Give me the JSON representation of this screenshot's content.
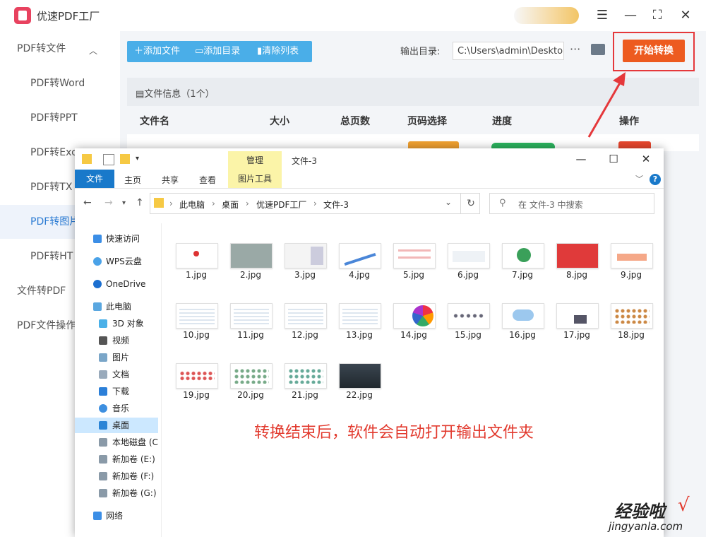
{
  "app": {
    "title": "优速PDF工厂"
  },
  "sidebar": {
    "items": [
      {
        "label": "PDF转文件"
      },
      {
        "label": "PDF转Word"
      },
      {
        "label": "PDF转PPT"
      },
      {
        "label": "PDF转Exc"
      },
      {
        "label": "PDF转TX"
      },
      {
        "label": "PDF转图片"
      },
      {
        "label": "PDF转HT"
      },
      {
        "label": "文件转PDF"
      },
      {
        "label": "PDF文件操作"
      }
    ]
  },
  "toolbar": {
    "add_file": "添加文件",
    "add_folder": "添加目录",
    "clear_list": "清除列表",
    "output_label": "输出目录:",
    "output_path": "C:\\Users\\admin\\Deskto",
    "more": "···",
    "start": "开始转换"
  },
  "file_info": {
    "label": "文件信息（1个）"
  },
  "table": {
    "headers": [
      "文件名",
      "大小",
      "总页数",
      "页码选择",
      "进度",
      "操作"
    ]
  },
  "explorer": {
    "title": "文件-3",
    "manage_tab": "管理",
    "picture_tools": "图片工具",
    "ribbon_tabs": [
      "文件",
      "主页",
      "共享",
      "查看"
    ],
    "breadcrumb": [
      "此电脑",
      "桌面",
      "优速PDF工厂",
      "文件-3"
    ],
    "search_placeholder": "在 文件-3 中搜索",
    "nav": [
      {
        "label": "快速访问"
      },
      {
        "label": "WPS云盘"
      },
      {
        "label": "OneDrive"
      },
      {
        "label": "此电脑"
      },
      {
        "label": "3D 对象"
      },
      {
        "label": "视频"
      },
      {
        "label": "图片"
      },
      {
        "label": "文档"
      },
      {
        "label": "下载"
      },
      {
        "label": "音乐"
      },
      {
        "label": "桌面"
      },
      {
        "label": "本地磁盘 (C"
      },
      {
        "label": "新加卷 (E:)"
      },
      {
        "label": "新加卷 (F:)"
      },
      {
        "label": "新加卷 (G:)"
      },
      {
        "label": "网络"
      }
    ],
    "files": [
      "1.jpg",
      "2.jpg",
      "3.jpg",
      "4.jpg",
      "5.jpg",
      "6.jpg",
      "7.jpg",
      "8.jpg",
      "9.jpg",
      "10.jpg",
      "11.jpg",
      "12.jpg",
      "13.jpg",
      "14.jpg",
      "15.jpg",
      "16.jpg",
      "17.jpg",
      "18.jpg",
      "19.jpg",
      "20.jpg",
      "21.jpg",
      "22.jpg"
    ]
  },
  "caption": "转换结束后，软件会自动打开输出文件夹",
  "watermark": {
    "title": "经验啦",
    "url": "jingyanla.com",
    "check": "√"
  },
  "colors": {
    "accent": "#ed5b20",
    "highlight": "#e5383b",
    "toolbar": "#4aaee8",
    "explorer_blue": "#1979ca"
  }
}
